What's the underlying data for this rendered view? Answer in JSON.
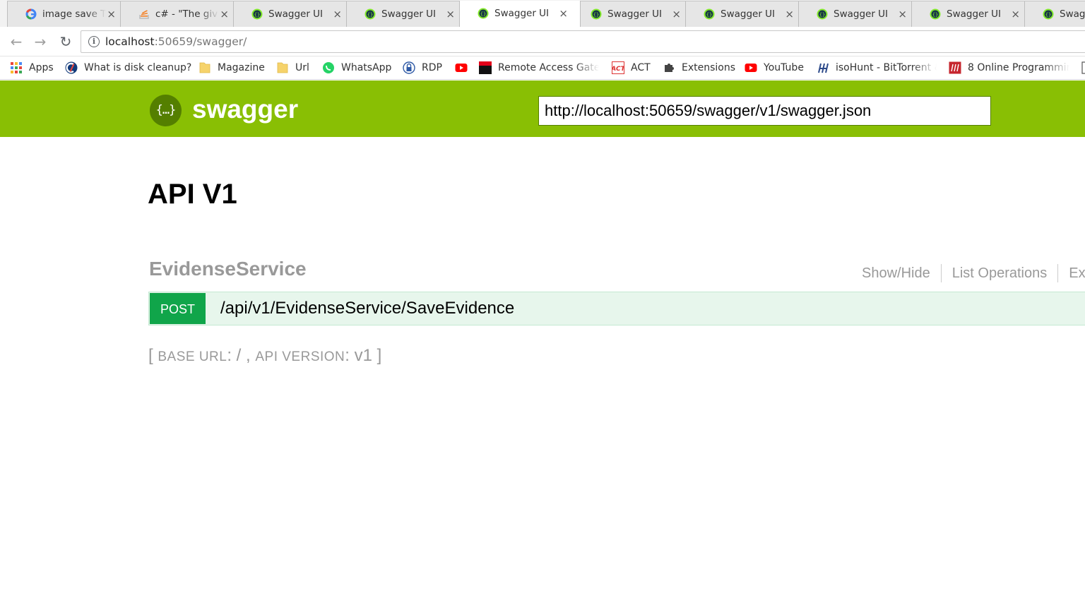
{
  "browser": {
    "tabs": [
      {
        "title": "image save T",
        "icon": "google-icon",
        "active": false
      },
      {
        "title": "c# - \"The giv",
        "icon": "stackoverflow-icon",
        "active": false
      },
      {
        "title": "Swagger UI",
        "icon": "swagger-icon",
        "active": false
      },
      {
        "title": "Swagger UI",
        "icon": "swagger-icon",
        "active": false
      },
      {
        "title": "Swagger UI",
        "icon": "swagger-icon",
        "active": true
      },
      {
        "title": "Swagger UI",
        "icon": "swagger-icon",
        "active": false
      },
      {
        "title": "Swagger UI",
        "icon": "swagger-icon",
        "active": false
      },
      {
        "title": "Swagger UI",
        "icon": "swagger-icon",
        "active": false
      },
      {
        "title": "Swagger UI",
        "icon": "swagger-icon",
        "active": false
      },
      {
        "title": "Swagg",
        "icon": "swagger-icon",
        "active": false
      }
    ],
    "close_glyph": "×",
    "address": {
      "host": "localhost",
      "path": ":50659/swagger/"
    },
    "bookmarks": [
      {
        "label": "Apps",
        "icon": "apps-grid-icon"
      },
      {
        "label": "What is disk cleanup?",
        "icon": "ccleaner-icon"
      },
      {
        "label": "Magazine",
        "icon": "folder-icon"
      },
      {
        "label": "Url",
        "icon": "folder-icon"
      },
      {
        "label": "WhatsApp",
        "icon": "whatsapp-icon"
      },
      {
        "label": "RDP",
        "icon": "rdp-lock-icon"
      },
      {
        "label": "",
        "icon": "youtube-icon"
      },
      {
        "label": "Remote Access Gatew",
        "icon": "remote-access-icon"
      },
      {
        "label": "ACT",
        "icon": "act-icon"
      },
      {
        "label": "Extensions",
        "icon": "puzzle-icon"
      },
      {
        "label": "YouTube",
        "icon": "youtube-icon"
      },
      {
        "label": "isoHunt - BitTorrent &",
        "icon": "isohunt-icon"
      },
      {
        "label": "8 Online Programmin",
        "icon": "programming-icon"
      }
    ]
  },
  "swagger": {
    "logo_glyph": "{…}",
    "logo_text": "swagger",
    "spec_url": "http://localhost:50659/swagger/v1/swagger.json",
    "api_title": "API V1",
    "resource": {
      "name": "EvidenseService",
      "links": [
        "Show/Hide",
        "List Operations",
        "Ex"
      ]
    },
    "operation": {
      "method": "POST",
      "path": "/api/v1/EvidenseService/SaveEvidence"
    },
    "footer": {
      "open": "[ ",
      "base_label": "BASE URL",
      "base_value": ": / , ",
      "version_label": "API VERSION",
      "version_value": ": v1 ",
      "close": "]"
    }
  },
  "colors": {
    "swagger_green": "#89bf04",
    "logo_dark": "#547f00",
    "post_green": "#10a54a",
    "op_bg": "#e7f6ec"
  }
}
